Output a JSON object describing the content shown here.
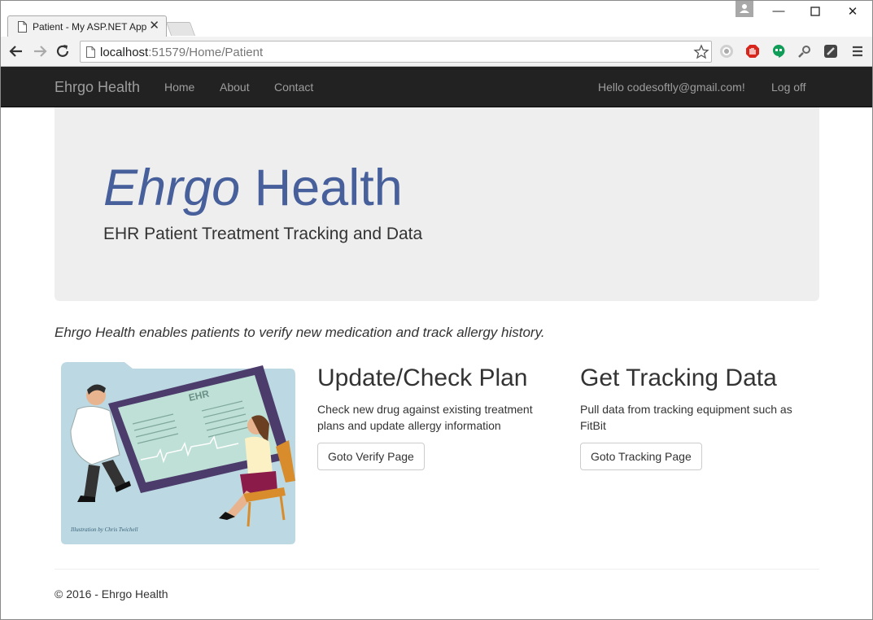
{
  "browser": {
    "tab_title": "Patient - My ASP.NET App",
    "url_host": "localhost",
    "url_rest": ":51579/Home/Patient"
  },
  "site": {
    "brand": "Ehrgo Health",
    "nav": [
      "Home",
      "About",
      "Contact"
    ],
    "greeting": "Hello codesoftly@gmail.com!",
    "logoff": "Log off"
  },
  "jumbotron": {
    "title_italic": "Ehrgo",
    "title_rest": " Health",
    "subtitle": "EHR Patient Treatment Tracking and Data"
  },
  "lead": "Ehrgo Health enables patients to verify new medication and track allergy history.",
  "illustration": {
    "screen_label": "EHR",
    "credit": "Illustration by Chris Twichell"
  },
  "features": [
    {
      "heading": "Update/Check Plan",
      "text": "Check new drug against existing treatment plans and update allergy information",
      "button": "Goto Verify Page"
    },
    {
      "heading": "Get Tracking Data",
      "text": "Pull data from tracking equipment such as FitBit",
      "button": "Goto Tracking Page"
    }
  ],
  "footer": "© 2016 - Ehrgo Health",
  "colors": {
    "navbar": "#222222",
    "brand_blue": "#47609b",
    "jumbotron": "#eeeeee"
  }
}
